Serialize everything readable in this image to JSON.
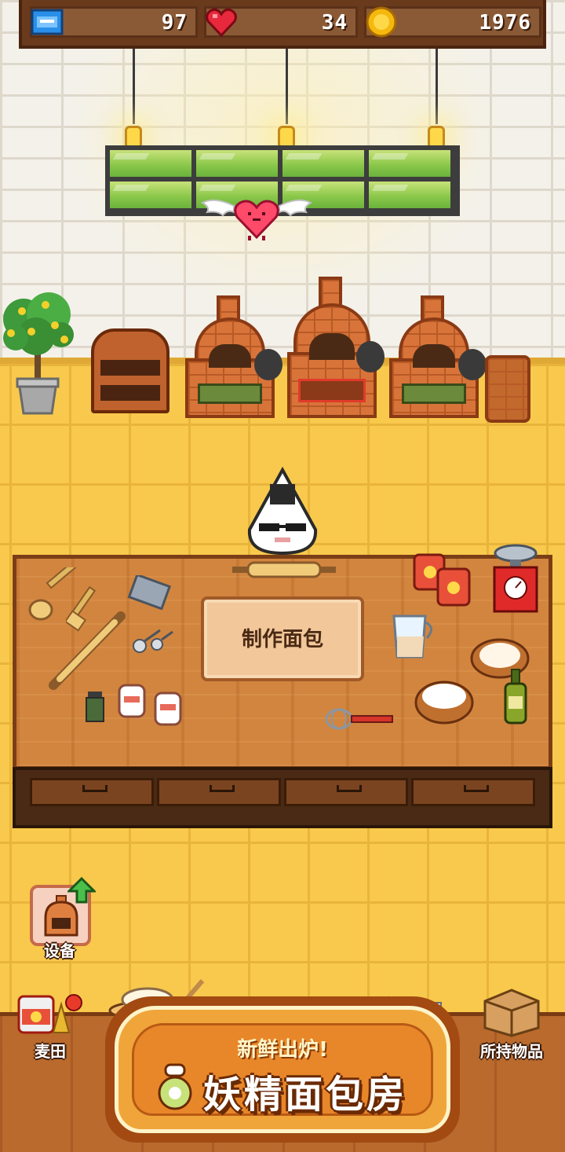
{
  "hud": {
    "tickets": "97",
    "hearts": "34",
    "coins": "1976"
  },
  "counter": {
    "make_bread_label": "制作面包"
  },
  "side_buttons": {
    "equipment_label": "设备"
  },
  "bottom_nav": {
    "wheat_field_label": "麦田",
    "inventory_label": "所持物品"
  },
  "logo": {
    "subtitle": "新鲜出炉!",
    "title": "妖精面包房"
  },
  "colors": {
    "floor": "#f8c94c",
    "wall": "#f4f1ea",
    "hud": "#6a3a1c",
    "counter": "#d2853e",
    "logo_orange": "#f0a53a"
  }
}
